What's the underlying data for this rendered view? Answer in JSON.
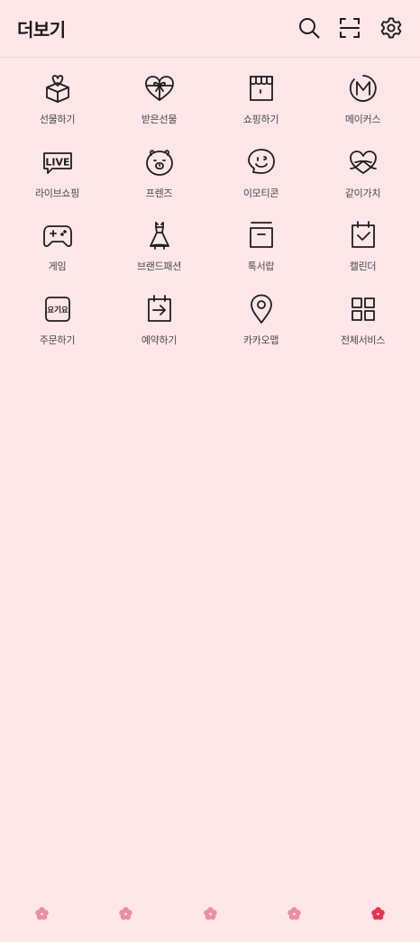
{
  "header": {
    "title": "더보기",
    "icons": [
      "search-icon",
      "scan-icon",
      "gear-icon"
    ]
  },
  "services": [
    {
      "label": "선물하기",
      "icon": "gift-box-icon"
    },
    {
      "label": "받은선물",
      "icon": "received-gift-heart-icon"
    },
    {
      "label": "쇼핑하기",
      "icon": "shop-store-icon"
    },
    {
      "label": "메이커스",
      "icon": "makers-m-icon"
    },
    {
      "label": "라이브쇼핑",
      "icon": "live-badge-icon"
    },
    {
      "label": "프렌즈",
      "icon": "bear-face-icon"
    },
    {
      "label": "이모티콘",
      "icon": "emoticon-face-icon"
    },
    {
      "label": "같이가치",
      "icon": "together-heart-icon"
    },
    {
      "label": "게임",
      "icon": "gamepad-icon"
    },
    {
      "label": "브랜드패션",
      "icon": "dress-icon"
    },
    {
      "label": "톡서랍",
      "icon": "drawer-box-icon"
    },
    {
      "label": "캘린더",
      "icon": "calendar-check-icon"
    },
    {
      "label": "주문하기",
      "icon": "order-badge-icon"
    },
    {
      "label": "예약하기",
      "icon": "calendar-arrow-icon"
    },
    {
      "label": "카카오맵",
      "icon": "map-pin-icon"
    },
    {
      "label": "전체서비스",
      "icon": "grid-icon"
    }
  ],
  "order_badge_text": "요기요",
  "live_badge_text": "LIVE",
  "tabbar": {
    "tabs": [
      {
        "icon": "flower-icon",
        "active": false
      },
      {
        "icon": "flower-icon",
        "active": false
      },
      {
        "icon": "flower-icon",
        "active": false
      },
      {
        "icon": "flower-icon",
        "active": false
      },
      {
        "icon": "flower-icon",
        "active": true
      }
    ]
  },
  "colors": {
    "background": "#FFE6E9",
    "icon_stroke": "#1E1E1E",
    "label_text": "#4A4A4A",
    "tab_inactive": "#EE8FA0",
    "tab_active": "#E8344E"
  }
}
